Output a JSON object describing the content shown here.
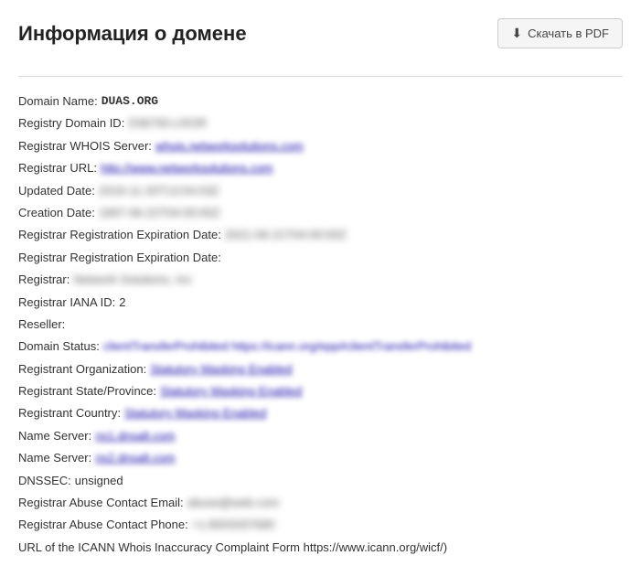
{
  "header": {
    "title": "Информация о домене",
    "download_btn": "Скачать в PDF"
  },
  "whois": {
    "domain_name_label": "Domain Name:",
    "domain_name_value": "DUAS.ORG",
    "registry_id_label": "Registry Domain ID:",
    "registry_id_value": "D36765-LROR",
    "registrar_whois_label": "Registrar WHOIS Server:",
    "registrar_whois_value": "whois.networksolutions.com",
    "registrar_url_label": "Registrar URL:",
    "registrar_url_value": "http://www.networksolutions.com",
    "updated_date_label": "Updated Date:",
    "updated_date_value": "2019-11-20T13:54:03Z",
    "creation_date_label": "Creation Date:",
    "creation_date_value": "1997-06-22T04:00:00Z",
    "expiration_date_label1": "Registrar Registration Expiration Date:",
    "expiration_date_value1": "2021-06-21T04:00:00Z",
    "expiration_date_label2": "Registrar Registration Expiration Date:",
    "registrar_label": "Registrar:",
    "registrar_value": "Network Solutions, Inc",
    "iana_label": "Registrar IANA ID:",
    "iana_value": "2",
    "reseller_label": "Reseller:",
    "status_label": "Domain Status:",
    "status_value": "clientTransferProhibited https://icann.org/epp#clientTransferProhibited",
    "reg_org_label": "Registrant Organization:",
    "reg_org_value": "Statutory Masking Enabled",
    "reg_state_label": "Registrant State/Province:",
    "reg_state_value": "Statutory Masking Enabled",
    "reg_country_label": "Registrant Country:",
    "reg_country_value": "Statutory Masking Enabled",
    "ns1_label": "Name Server:",
    "ns1_value": "ns1.dnsalt.com",
    "ns2_label": "Name Server:",
    "ns2_value": "ns2.dnsalt.com",
    "dnssec_label": "DNSSEC:",
    "dnssec_value": "unsigned",
    "abuse_email_label": "Registrar Abuse Contact Email:",
    "abuse_email_value": "abuse@web.com",
    "abuse_phone_label": "Registrar Abuse Contact Phone:",
    "abuse_phone_value": "+1.8003337680",
    "icann_label": "URL of the ICANN Whois Inaccuracy Complaint Form https://www.icann.org/wicf/)"
  }
}
